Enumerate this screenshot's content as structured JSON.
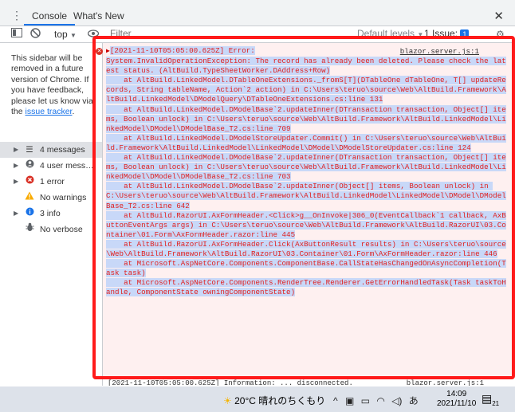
{
  "tabs": {
    "console": "Console",
    "whats_new": "What's New"
  },
  "toolbar": {
    "context": "top",
    "filter_placeholder": "Filter",
    "levels": "Default levels",
    "issue_label": "1 Issue:",
    "issue_count": "1"
  },
  "sidebar": {
    "note": "This sidebar will be removed in a future version of Chrome. If you have feedback, please let us know via the",
    "link": "issue tracker",
    "note_end": ".",
    "items": [
      {
        "label": "4 messages"
      },
      {
        "label": "4 user mess…"
      },
      {
        "label": "1 error"
      },
      {
        "label": "No warnings"
      },
      {
        "label": "3 info"
      },
      {
        "label": "No verbose"
      }
    ]
  },
  "error": {
    "source": "blazor.server.js:1",
    "first_line": "[2021-11-10T05:05:00.625Z] Error:",
    "body": "System.InvalidOperationException: The record has already been deleted. Please check the latest status. (AltBuild.TypeSheetWorker.DAddress+Row)\n    at AltBuild.LinkedModel.DTableOneExtensions._fromS[T](DTableOne dTableOne, T[] updateRecords, String tableName, Action`2 action) in C:\\Users\\teruo\\source\\Web\\AltBuild.Framework\\AltBuild.LinkedModel\\DModelQuery\\DTableOneExtensions.cs:line 131\n    at AltBuild.LinkedModel.DModelBase`2.updateInner(DTransaction transaction, Object[] items, Boolean unlock) in C:\\Users\\teruo\\source\\Web\\AltBuild.Framework\\AltBuild.LinkedModel\\LinkedModel\\DModel\\DModelBase_T2.cs:line 709\n    at AltBuild.LinkedModel.DModelStoreUpdater.Commit() in C:\\Users\\teruo\\source\\Web\\AltBuild.Framework\\AltBuild.LinkedModel\\LinkedModel\\DModel\\DModelStoreUpdater.cs:line 124\n    at AltBuild.LinkedModel.DModelBase`2.updateInner(DTransaction transaction, Object[] items, Boolean unlock) in C:\\Users\\teruo\\source\\Web\\AltBuild.Framework\\AltBuild.LinkedModel\\LinkedModel\\DModel\\DModelBase_T2.cs:line 703\n    at AltBuild.LinkedModel.DModelBase`2.updateInner(Object[] items, Boolean unlock) in C:\\Users\\teruo\\source\\Web\\AltBuild.Framework\\AltBuild.LinkedModel\\LinkedModel\\DModel\\DModelBase_T2.cs:line 642\n    at AltBuild.RazorUI.AxFormHeader.<Click>g__OnInvoke|306_0(EventCallback`1 callback, AxButtonEventArgs args) in C:\\Users\\teruo\\source\\Web\\AltBuild.Framework\\AltBuild.RazorUI\\03.Container\\01.Form\\AxFormHeader.razor:line 445\n    at AltBuild.RazorUI.AxFormHeader.Click(AxButtonResult results) in C:\\Users\\teruo\\source\\Web\\AltBuild.Framework\\AltBuild.RazorUI\\03.Container\\01.Form\\AxFormHeader.razor:line 446\n    at Microsoft.AspNetCore.Components.ComponentBase.CallStateHasChangedOnAsyncCompletion(Task task)\n    at Microsoft.AspNetCore.Components.RenderTree.Renderer.GetErrorHandledTask(Task taskToHandle, ComponentState owningComponentState)"
  },
  "next_entry": {
    "text": "[2021-11-10T05:05:00.625Z] Information: ... disconnected.",
    "source": "blazor.server.js:1"
  },
  "taskbar": {
    "weather": "20°C 晴れのちくもり",
    "ime": "あ",
    "time": "14:09",
    "date": "2021/11/10",
    "notif_count": "21"
  },
  "colors": {
    "error_text": "#e02020",
    "highlight": "#c8d8f8",
    "annotation": "#ff1a1a",
    "accent": "#1a73e8"
  }
}
